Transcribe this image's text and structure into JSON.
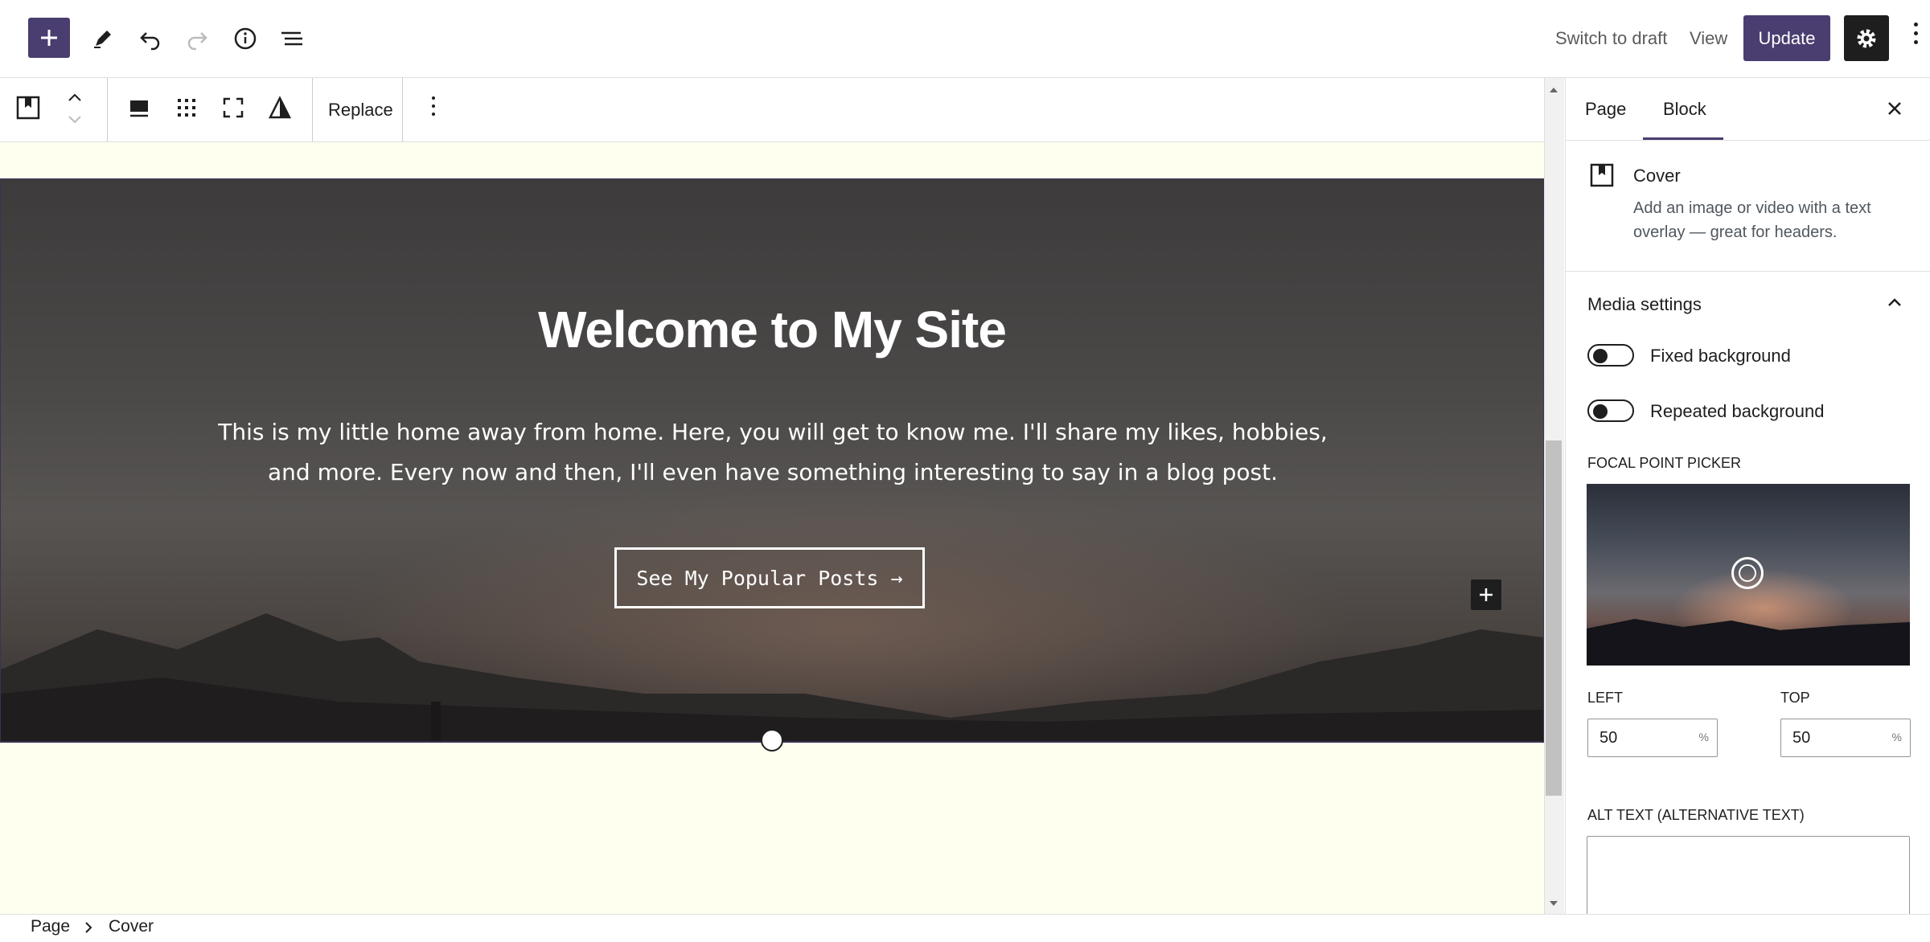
{
  "header": {
    "switch_to_draft": "Switch to draft",
    "view": "View",
    "update": "Update"
  },
  "block_toolbar": {
    "replace_label": "Replace"
  },
  "cover": {
    "title": "Welcome to My Site",
    "paragraph": "This is my little home away from home. Here, you will get to know me.  I'll share my likes, hobbies, and more.  Every now and then, I'll even have something interesting to say in a blog post.",
    "button_label": "See My Popular Posts →"
  },
  "sidebar": {
    "tabs": [
      "Page",
      "Block"
    ],
    "active_tab": "Block",
    "block_name": "Cover",
    "block_description": "Add an image or video with a text overlay — great for headers.",
    "media_settings_title": "Media settings",
    "toggles": [
      {
        "label": "Fixed background",
        "on": false
      },
      {
        "label": "Repeated background",
        "on": false
      }
    ],
    "focal_point_label": "FOCAL POINT PICKER",
    "left_label": "LEFT",
    "left_value": "50",
    "top_label": "TOP",
    "top_value": "50",
    "unit": "%",
    "alt_text_label": "ALT TEXT (ALTERNATIVE TEXT)",
    "alt_text_value": ""
  },
  "breadcrumb": [
    "Page",
    "Cover"
  ],
  "colors": {
    "accent": "#4a3d6f",
    "canvas_bg": "#fffff0",
    "dark": "#1e1e1e"
  }
}
